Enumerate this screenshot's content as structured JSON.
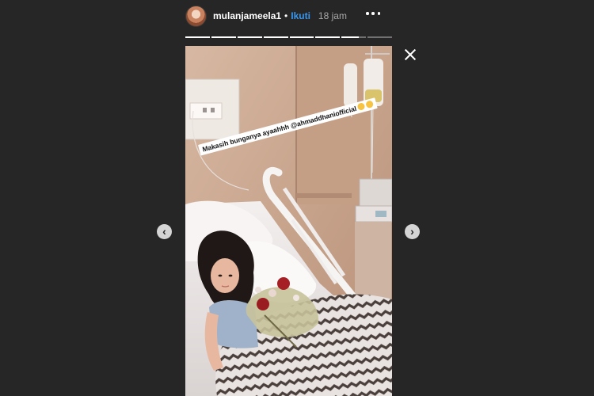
{
  "header": {
    "username": "mulanjameela1",
    "separator": "•",
    "follow_label": "Ikuti",
    "time": "18 jam"
  },
  "progress": {
    "segment_count": 8,
    "current_index": 6,
    "current_fraction": 0.7
  },
  "story": {
    "caption_text": "Makasih bunganya ayaahhh @ahmaddhaniofficial"
  },
  "icons": {
    "close": "close-icon",
    "more": "more-options-icon",
    "prev": "chevron-left-icon",
    "next": "chevron-right-icon",
    "prev_glyph": "‹",
    "next_glyph": "›"
  }
}
